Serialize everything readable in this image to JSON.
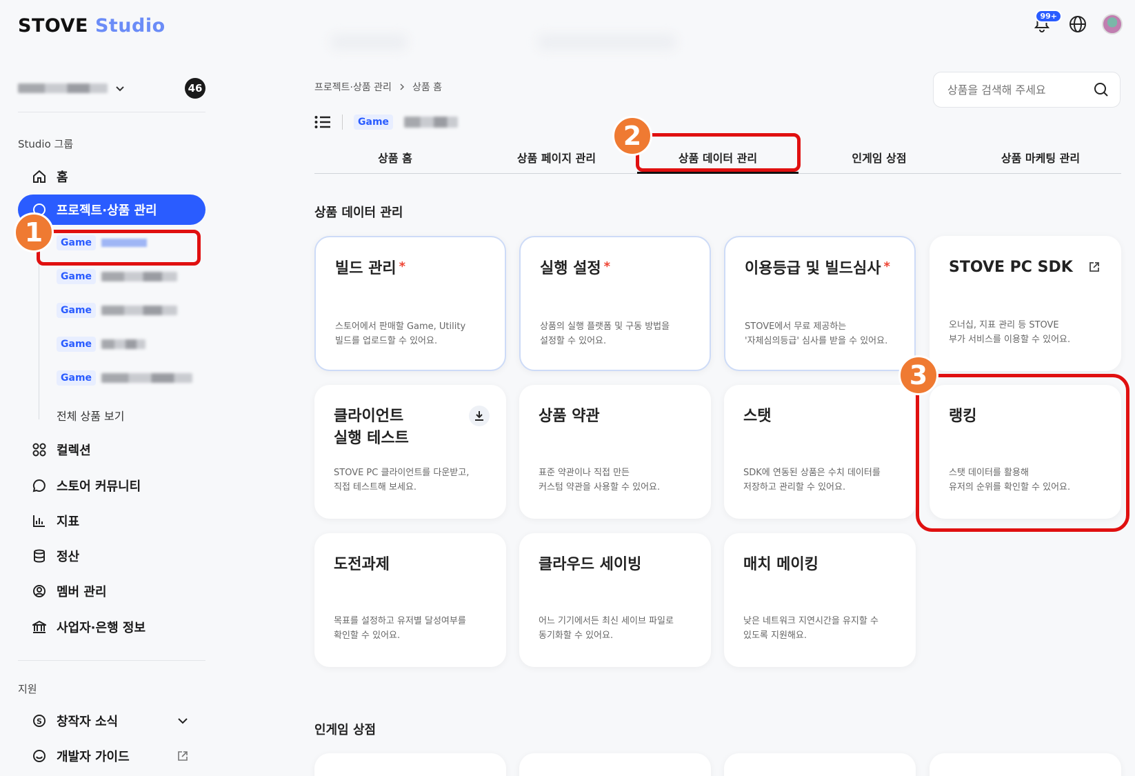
{
  "header": {
    "logo_main": "STOVE",
    "logo_sub": "Studio",
    "notif_badge": "99+"
  },
  "sidebar": {
    "team_count": "46",
    "group_label": "Studio 그룹",
    "items": [
      {
        "label": "홈",
        "icon": "home-icon"
      },
      {
        "label": "프로젝트·상품 관리",
        "icon": "project-icon",
        "active": true
      },
      {
        "label": "컬렉션",
        "icon": "collection-icon"
      },
      {
        "label": "스토어 커뮤니티",
        "icon": "community-icon"
      },
      {
        "label": "지표",
        "icon": "chart-icon"
      },
      {
        "label": "정산",
        "icon": "database-icon"
      },
      {
        "label": "멤버 관리",
        "icon": "member-icon"
      },
      {
        "label": "사업자·은행 정보",
        "icon": "bank-icon"
      }
    ],
    "sub_items": [
      {
        "tag": "Game"
      },
      {
        "tag": "Game"
      },
      {
        "tag": "Game"
      },
      {
        "tag": "Game"
      },
      {
        "tag": "Game"
      }
    ],
    "all_products": "전체 상품 보기",
    "support_label": "지원",
    "support_items": [
      {
        "label": "창작자 소식",
        "icon": "dollar-icon"
      },
      {
        "label": "개발자 가이드",
        "icon": "smile-icon"
      }
    ]
  },
  "main": {
    "breadcrumb": [
      "프로젝트·상품 관리",
      "상품 홈"
    ],
    "search_placeholder": "상품을 검색해 주세요",
    "product_tag": "Game",
    "tabs": [
      "상품 홈",
      "상품 페이지 관리",
      "상품 데이터 관리",
      "인게임 상점",
      "상품 마케팅 관리"
    ],
    "active_tab": 2,
    "section_title": "상품 데이터 관리",
    "cards": [
      {
        "title": "빌드 관리",
        "required": true,
        "desc1": "스토어에서 판매할 Game, Utility",
        "desc2": "빌드를 업로드할 수 있어요."
      },
      {
        "title": "실행 설정",
        "required": true,
        "desc1": "상품의 실행 플랫폼 및 구동 방법을",
        "desc2": "설정할 수 있어요."
      },
      {
        "title": "이용등급 및 빌드심사",
        "required": true,
        "desc1": "STOVE에서 무료 제공하는",
        "desc2": "'자체심의등급' 심사를 받을 수 있어요."
      },
      {
        "title": "STOVE PC SDK",
        "required": false,
        "desc1": "오너십, 지표 관리 등 STOVE",
        "desc2": "부가 서비스를 이용할 수 있어요."
      },
      {
        "title1": "클라이언트",
        "title2": "실행 테스트",
        "desc1": "STOVE PC 클라이언트를 다운받고,",
        "desc2": "직접 테스트해 보세요."
      },
      {
        "title": "상품 약관",
        "desc1": "표준 약관이나 직접 만든",
        "desc2": "커스텀 약관을 사용할 수 있어요."
      },
      {
        "title": "스탯",
        "desc1": "SDK에 연동된 상품은 수치 데이터를",
        "desc2": "저장하고 관리할 수 있어요."
      },
      {
        "title": "랭킹",
        "desc1": "스탯 데이터를 활용해",
        "desc2": "유저의 순위를 확인할 수 있어요."
      },
      {
        "title": "도전과제",
        "desc1": "목표를 설정하고 유저별 달성여부를",
        "desc2": "확인할 수 있어요."
      },
      {
        "title": "클라우드 세이빙",
        "desc1": "어느 기기에서든 최신 세이브 파일로",
        "desc2": "동기화할 수 있어요."
      },
      {
        "title": "매치 메이킹",
        "desc1": "낮은 네트워크 지연시간을 유지할 수",
        "desc2": "있도록 지원해요."
      }
    ],
    "section2_title": "인게임 상점"
  },
  "annotations": [
    "1",
    "2",
    "3"
  ],
  "colors": {
    "accent": "#2a5cff",
    "highlight": "#e01010",
    "marker": "#ef7a32"
  }
}
